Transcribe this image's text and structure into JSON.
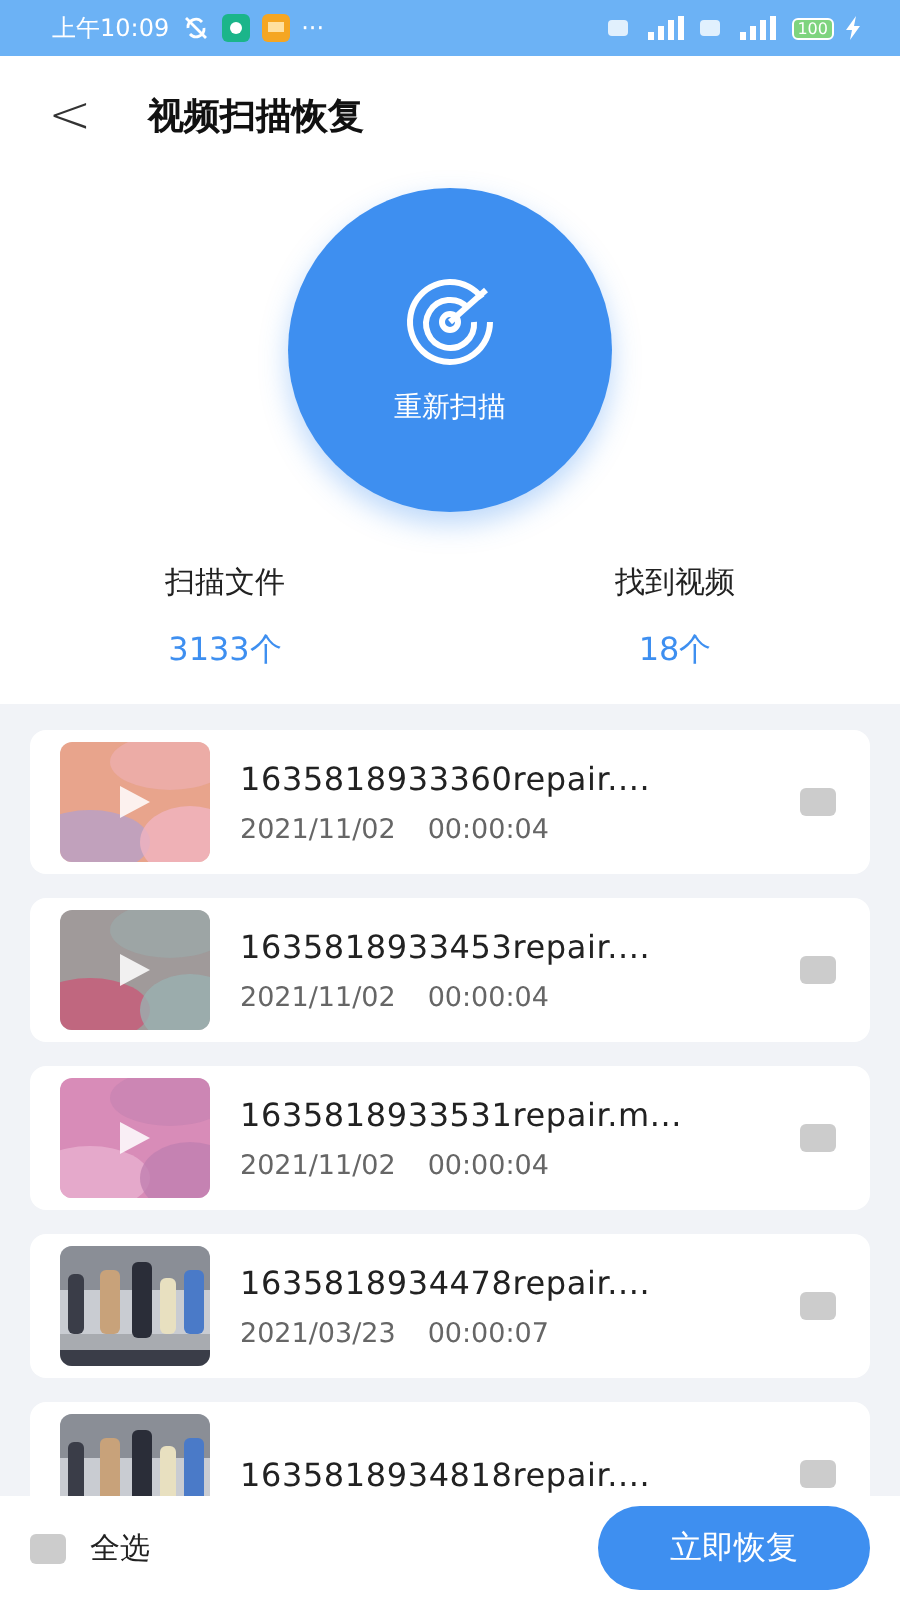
{
  "status_bar": {
    "time": "上午10:09",
    "more": "···",
    "battery": "100"
  },
  "header": {
    "back": "<",
    "title": "视频扫描恢复"
  },
  "scan_button": {
    "label": "重新扫描"
  },
  "stats": [
    {
      "label": "扫描文件",
      "value": "3133个"
    },
    {
      "label": "找到视频",
      "value": "18个"
    }
  ],
  "videos": [
    {
      "name": "1635818933360repair....",
      "date": "2021/11/02",
      "duration": "00:00:04",
      "checked": false,
      "thumbnail": {
        "kind": "picture",
        "play_overlay": true
      }
    },
    {
      "name": "1635818933453repair....",
      "date": "2021/11/02",
      "duration": "00:00:04",
      "checked": false,
      "thumbnail": {
        "kind": "picture",
        "play_overlay": true
      }
    },
    {
      "name": "1635818933531repair.m...",
      "date": "2021/11/02",
      "duration": "00:00:04",
      "checked": false,
      "thumbnail": {
        "kind": "picture",
        "play_overlay": true
      }
    },
    {
      "name": "1635818934478repair....",
      "date": "2021/03/23",
      "duration": "00:00:07",
      "checked": false,
      "thumbnail": {
        "kind": "picture",
        "play_overlay": false
      }
    },
    {
      "name": "1635818934818repair....",
      "checked": false,
      "thumbnail": {
        "kind": "picture",
        "play_overlay": false
      }
    }
  ],
  "footer": {
    "select_all": {
      "label": "全选",
      "checked": false
    },
    "restore_button": "立即恢复"
  }
}
